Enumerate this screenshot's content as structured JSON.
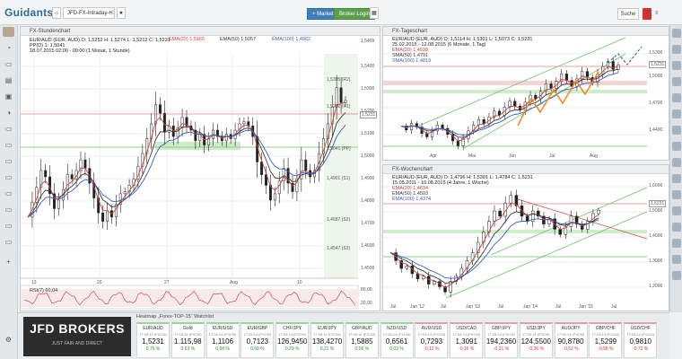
{
  "app": {
    "logo": "Guidants",
    "tab_label": "JFD-FX-Intraday-H1-D-W",
    "search_label": "Suche",
    "market_button": "+ Market",
    "broker_button": "Broker Login"
  },
  "left_chart": {
    "title": "FX-Stundenchart",
    "info_line1": "EUR/AUD (EUR, AUD) O: 1,5252 H: 1,5274 L: 1,5212 C: 1,5231",
    "info_line2": "PP(D) 1: 1,5041",
    "info_line3": "18.07.2015 02:00 - 09:00 (1 Monat, 1 Stunde)",
    "ema20": "EMA(20) 1,5165",
    "ema50": "EMA(50) 1,5057",
    "ema100": "EMA(100) 1,4962",
    "y_ticks": [
      "1,5400",
      "1,5300",
      "1,5200",
      "1,5100",
      "1,5000",
      "1,4900",
      "1,4800",
      "1,4700",
      "1,4600",
      "1,4500"
    ],
    "x_ticks": [
      "13",
      "20",
      "27",
      "Aug",
      "10"
    ],
    "levels": [
      "1,5395 (R2)",
      "1,5200 (R1)",
      "1,5041 (PP)",
      "1,4901 (S1)",
      "1,4687 (S2)",
      "1,4547 (S3)"
    ],
    "current": "1,5231",
    "level_top": "1,5409",
    "rsi_label": "RSI(7) 60,04",
    "rsi_ticks": [
      "80,00",
      "20,00"
    ],
    "series": [
      1.468,
      1.475,
      1.482,
      1.49,
      1.487,
      1.479,
      1.472,
      1.476,
      1.481,
      1.488,
      1.486,
      1.49,
      1.495,
      1.491,
      1.484,
      1.477,
      1.47,
      1.466,
      1.471,
      1.468,
      1.474,
      1.479,
      1.48,
      1.483,
      1.486,
      1.492,
      1.498,
      1.505,
      1.512,
      1.521,
      1.517,
      1.508,
      1.511,
      1.506,
      1.51,
      1.515,
      1.511,
      1.509,
      1.504,
      1.507,
      1.502,
      1.505,
      1.509,
      1.506,
      1.504,
      1.507,
      1.505,
      1.509,
      1.512,
      1.513,
      1.511,
      1.506,
      1.494,
      1.488,
      1.483,
      1.476,
      1.479,
      1.485,
      1.491,
      1.484,
      1.48,
      1.486,
      1.495,
      1.49,
      1.487,
      1.49,
      1.498,
      1.505,
      1.512,
      1.52,
      1.529,
      1.522,
      1.523
    ]
  },
  "right_top": {
    "title": "FX-Tageschart",
    "info_line1": "EUR/AUD (EUR, AUD) O: 1,5114 H: 1,5301 L: 1,5073 C: 1,5231",
    "info_line2": "25.02.2015 - 12.08.2015 (6 Monate, 1 Tag)",
    "ema20": "EMA(20) 1,4938",
    "sma50": "SMA(50) 1,4791",
    "sma100": "SMA(100) 1,4819",
    "y_ticks": [
      "1,5300",
      "1,5000",
      "1,4700",
      "1,4400"
    ],
    "x_ticks": [
      "Apr",
      "Mai",
      "Jun",
      "Jul",
      "Aug"
    ],
    "current": "1,5231",
    "series": [
      1.4,
      1.392,
      1.405,
      1.398,
      1.385,
      1.378,
      1.39,
      1.402,
      1.395,
      1.383,
      1.37,
      1.36,
      1.375,
      1.39,
      1.402,
      1.413,
      1.405,
      1.418,
      1.43,
      1.422,
      1.438,
      1.45,
      1.44,
      1.432,
      1.448,
      1.462,
      1.455,
      1.47,
      1.485,
      1.476,
      1.49,
      1.505,
      1.492,
      1.48,
      1.495,
      1.51,
      1.498,
      1.488,
      1.505,
      1.52,
      1.53,
      1.514,
      1.523
    ]
  },
  "right_bottom": {
    "title": "FX-Wochenchart",
    "info_line1": "EUR/AUD (EUR, AUD) O: 1,4796 H: 1,5301 L: 1,4784 C: 1,5231",
    "info_line2": "15.05.2011 - 10.08.2015 (4 Jahre, 1 Woche)",
    "ema20": "EMA(20) 1,4634",
    "ema50": "EMA(50) 1,4503",
    "ema100": "EMA(100) 1,4374",
    "y_ticks": [
      "1,6000",
      "1,5000",
      "1,4000",
      "1,3000",
      "1,2000"
    ],
    "x_ticks": [
      "Jul",
      "Jan '12",
      "Jul",
      "Jan '13",
      "Jul",
      "Jan '14",
      "Jul",
      "Jan '15",
      "Jul"
    ],
    "current": "1,5231",
    "series": [
      1.36,
      1.33,
      1.3,
      1.31,
      1.28,
      1.26,
      1.27,
      1.24,
      1.25,
      1.23,
      1.21,
      1.25,
      1.27,
      1.3,
      1.33,
      1.36,
      1.4,
      1.44,
      1.48,
      1.52,
      1.5,
      1.55,
      1.58,
      1.54,
      1.5,
      1.48,
      1.52,
      1.5,
      1.47,
      1.49,
      1.45,
      1.43,
      1.46,
      1.5,
      1.47,
      1.45,
      1.48,
      1.51,
      1.523
    ]
  },
  "watchlist": {
    "header": "Heatmap „Forex-TOP-15“ Watchlist",
    "broker_name": "JFD BROKERS",
    "broker_tag": "JUST FAIR AND DIRECT",
    "tiles": [
      {
        "name": "EUR/AUD",
        "time": "17:05:14 (FXCM)",
        "price": "1,5231",
        "change": "0,76 %",
        "dir": "up"
      },
      {
        "name": "Gold",
        "time": "17:05:14 (FXCM)",
        "price": "1.115,98",
        "change": "0,63 %",
        "dir": "up"
      },
      {
        "name": "EUR/USD",
        "time": "17:05:14 (FXCM)",
        "price": "1,1106",
        "change": "0,58 %",
        "dir": "up"
      },
      {
        "name": "EUR/GBP",
        "time": "17:05:14 (FXCM)",
        "price": "0,7123",
        "change": "0,60 %",
        "dir": "up"
      },
      {
        "name": "CHF/JPY",
        "time": "17:05:14 (FXCM)",
        "price": "126,9450",
        "change": "0,29 %",
        "dir": "up"
      },
      {
        "name": "EUR/JPY",
        "time": "17:05:14 (FXCM)",
        "price": "138,4270",
        "change": "0,21 %",
        "dir": "up"
      },
      {
        "name": "GBP/AUD",
        "time": "17:05:14 (FXCM)",
        "price": "1,5885",
        "change": "0,06 %",
        "dir": "up"
      },
      {
        "name": "NZD/USD",
        "time": "17:05:14 (FXCM)",
        "price": "0,6561",
        "change": "0,03 %",
        "dir": "up"
      },
      {
        "name": "AUD/USD",
        "time": "17:05:14 (FXCM)",
        "price": "0,7293",
        "change": "-0,12 %",
        "dir": "dn"
      },
      {
        "name": "USD/CAD",
        "time": "17:05:14 (FXCM)",
        "price": "1,3091",
        "change": "-0,16 %",
        "dir": "dn"
      },
      {
        "name": "GBP/JPY",
        "time": "17:05:14 (FXCM)",
        "price": "194,2360",
        "change": "-0,31 %",
        "dir": "dn"
      },
      {
        "name": "USD/JPY",
        "time": "17:05:14 (FXCM)",
        "price": "124,5500",
        "change": "-0,36 %",
        "dir": "dn"
      },
      {
        "name": "AUD/JPY",
        "time": "17:05:14 (FXCM)",
        "price": "90,8780",
        "change": "-0,52 %",
        "dir": "dn"
      },
      {
        "name": "GBP/CHF",
        "time": "17:05:14 (FXCM)",
        "price": "1,5299",
        "change": "-0,58 %",
        "dir": "dn"
      },
      {
        "name": "USD/CHF",
        "time": "17:05:14 (FXCM)",
        "price": "0,9810",
        "change": "-0,72 %",
        "dir": "dn"
      }
    ]
  },
  "colors": {
    "up": "#2d8b2d",
    "down": "#c33",
    "ema20": "#d04040",
    "ema50": "#3a3a3a",
    "ema100": "#3a5fbf"
  },
  "icons": [
    "home-icon",
    "chart-icon",
    "layout-icon",
    "news-icon",
    "portfolio-icon",
    "watchlist-icon",
    "settings-icon"
  ]
}
